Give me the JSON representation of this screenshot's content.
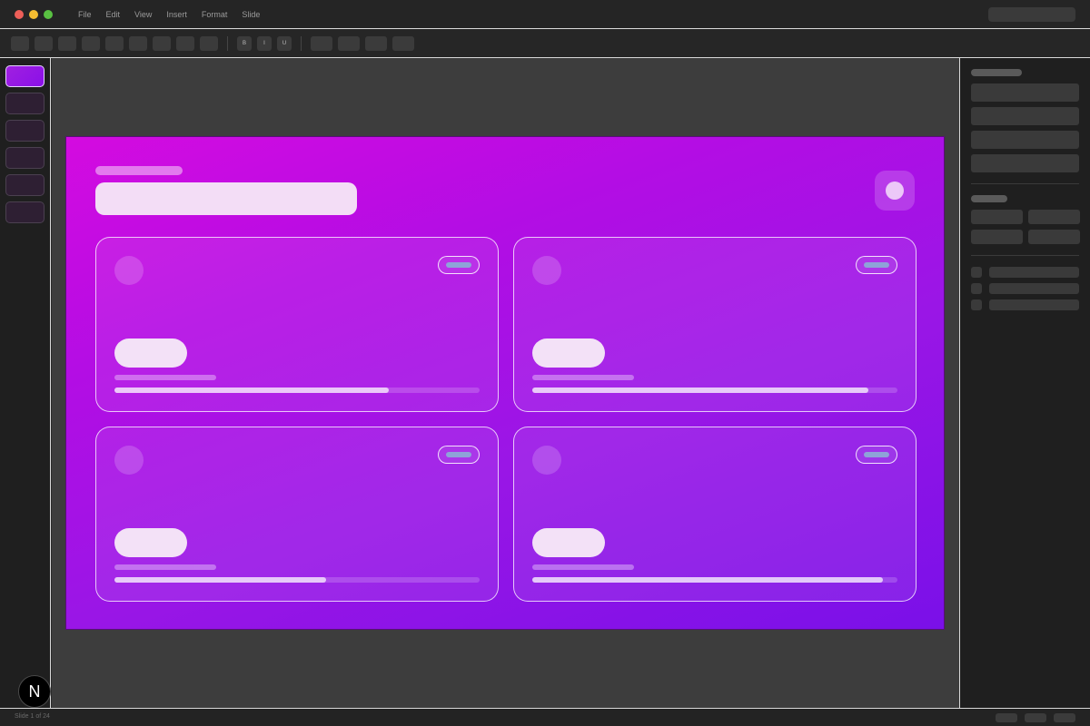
{
  "window": {
    "traffic_lights": [
      {
        "name": "close",
        "color": "#ed5f58"
      },
      {
        "name": "minimize",
        "color": "#f5bd31"
      },
      {
        "name": "maximize",
        "color": "#59c142"
      }
    ]
  },
  "menu": {
    "items": [
      "File",
      "Edit",
      "View",
      "Insert",
      "Format",
      "Slide"
    ]
  },
  "toolbar": {
    "format_buttons": [
      "B",
      "I",
      "U"
    ]
  },
  "slides": {
    "count": 6,
    "active_index": 0
  },
  "slide": {
    "background_gradient": [
      "#d40be0",
      "#7a10e8"
    ],
    "cards": [
      {
        "progress": 0.75
      },
      {
        "progress": 0.92
      },
      {
        "progress": 0.58
      },
      {
        "progress": 0.96
      }
    ]
  },
  "statusbar": {
    "text": "Slide 1 of 24"
  },
  "logo": {
    "letter": "N"
  }
}
